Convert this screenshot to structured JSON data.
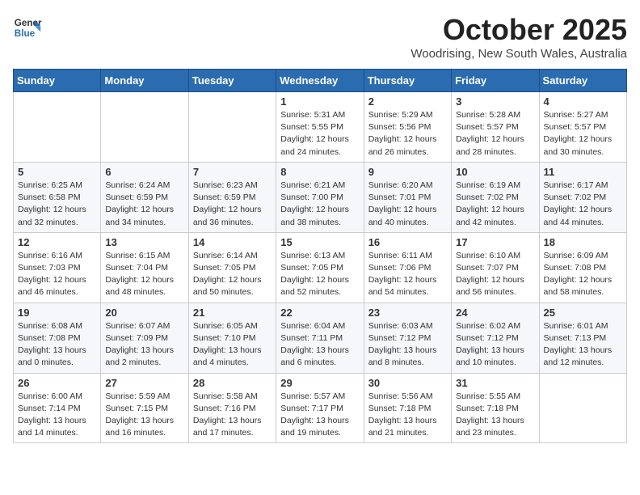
{
  "header": {
    "logo_line1": "General",
    "logo_line2": "Blue",
    "month": "October 2025",
    "location": "Woodrising, New South Wales, Australia"
  },
  "weekdays": [
    "Sunday",
    "Monday",
    "Tuesday",
    "Wednesday",
    "Thursday",
    "Friday",
    "Saturday"
  ],
  "weeks": [
    [
      {
        "day": "",
        "info": ""
      },
      {
        "day": "",
        "info": ""
      },
      {
        "day": "",
        "info": ""
      },
      {
        "day": "1",
        "info": "Sunrise: 5:31 AM\nSunset: 5:55 PM\nDaylight: 12 hours\nand 24 minutes."
      },
      {
        "day": "2",
        "info": "Sunrise: 5:29 AM\nSunset: 5:56 PM\nDaylight: 12 hours\nand 26 minutes."
      },
      {
        "day": "3",
        "info": "Sunrise: 5:28 AM\nSunset: 5:57 PM\nDaylight: 12 hours\nand 28 minutes."
      },
      {
        "day": "4",
        "info": "Sunrise: 5:27 AM\nSunset: 5:57 PM\nDaylight: 12 hours\nand 30 minutes."
      }
    ],
    [
      {
        "day": "5",
        "info": "Sunrise: 6:25 AM\nSunset: 6:58 PM\nDaylight: 12 hours\nand 32 minutes."
      },
      {
        "day": "6",
        "info": "Sunrise: 6:24 AM\nSunset: 6:59 PM\nDaylight: 12 hours\nand 34 minutes."
      },
      {
        "day": "7",
        "info": "Sunrise: 6:23 AM\nSunset: 6:59 PM\nDaylight: 12 hours\nand 36 minutes."
      },
      {
        "day": "8",
        "info": "Sunrise: 6:21 AM\nSunset: 7:00 PM\nDaylight: 12 hours\nand 38 minutes."
      },
      {
        "day": "9",
        "info": "Sunrise: 6:20 AM\nSunset: 7:01 PM\nDaylight: 12 hours\nand 40 minutes."
      },
      {
        "day": "10",
        "info": "Sunrise: 6:19 AM\nSunset: 7:02 PM\nDaylight: 12 hours\nand 42 minutes."
      },
      {
        "day": "11",
        "info": "Sunrise: 6:17 AM\nSunset: 7:02 PM\nDaylight: 12 hours\nand 44 minutes."
      }
    ],
    [
      {
        "day": "12",
        "info": "Sunrise: 6:16 AM\nSunset: 7:03 PM\nDaylight: 12 hours\nand 46 minutes."
      },
      {
        "day": "13",
        "info": "Sunrise: 6:15 AM\nSunset: 7:04 PM\nDaylight: 12 hours\nand 48 minutes."
      },
      {
        "day": "14",
        "info": "Sunrise: 6:14 AM\nSunset: 7:05 PM\nDaylight: 12 hours\nand 50 minutes."
      },
      {
        "day": "15",
        "info": "Sunrise: 6:13 AM\nSunset: 7:05 PM\nDaylight: 12 hours\nand 52 minutes."
      },
      {
        "day": "16",
        "info": "Sunrise: 6:11 AM\nSunset: 7:06 PM\nDaylight: 12 hours\nand 54 minutes."
      },
      {
        "day": "17",
        "info": "Sunrise: 6:10 AM\nSunset: 7:07 PM\nDaylight: 12 hours\nand 56 minutes."
      },
      {
        "day": "18",
        "info": "Sunrise: 6:09 AM\nSunset: 7:08 PM\nDaylight: 12 hours\nand 58 minutes."
      }
    ],
    [
      {
        "day": "19",
        "info": "Sunrise: 6:08 AM\nSunset: 7:08 PM\nDaylight: 13 hours\nand 0 minutes."
      },
      {
        "day": "20",
        "info": "Sunrise: 6:07 AM\nSunset: 7:09 PM\nDaylight: 13 hours\nand 2 minutes."
      },
      {
        "day": "21",
        "info": "Sunrise: 6:05 AM\nSunset: 7:10 PM\nDaylight: 13 hours\nand 4 minutes."
      },
      {
        "day": "22",
        "info": "Sunrise: 6:04 AM\nSunset: 7:11 PM\nDaylight: 13 hours\nand 6 minutes."
      },
      {
        "day": "23",
        "info": "Sunrise: 6:03 AM\nSunset: 7:12 PM\nDaylight: 13 hours\nand 8 minutes."
      },
      {
        "day": "24",
        "info": "Sunrise: 6:02 AM\nSunset: 7:12 PM\nDaylight: 13 hours\nand 10 minutes."
      },
      {
        "day": "25",
        "info": "Sunrise: 6:01 AM\nSunset: 7:13 PM\nDaylight: 13 hours\nand 12 minutes."
      }
    ],
    [
      {
        "day": "26",
        "info": "Sunrise: 6:00 AM\nSunset: 7:14 PM\nDaylight: 13 hours\nand 14 minutes."
      },
      {
        "day": "27",
        "info": "Sunrise: 5:59 AM\nSunset: 7:15 PM\nDaylight: 13 hours\nand 16 minutes."
      },
      {
        "day": "28",
        "info": "Sunrise: 5:58 AM\nSunset: 7:16 PM\nDaylight: 13 hours\nand 17 minutes."
      },
      {
        "day": "29",
        "info": "Sunrise: 5:57 AM\nSunset: 7:17 PM\nDaylight: 13 hours\nand 19 minutes."
      },
      {
        "day": "30",
        "info": "Sunrise: 5:56 AM\nSunset: 7:18 PM\nDaylight: 13 hours\nand 21 minutes."
      },
      {
        "day": "31",
        "info": "Sunrise: 5:55 AM\nSunset: 7:18 PM\nDaylight: 13 hours\nand 23 minutes."
      },
      {
        "day": "",
        "info": ""
      }
    ]
  ]
}
